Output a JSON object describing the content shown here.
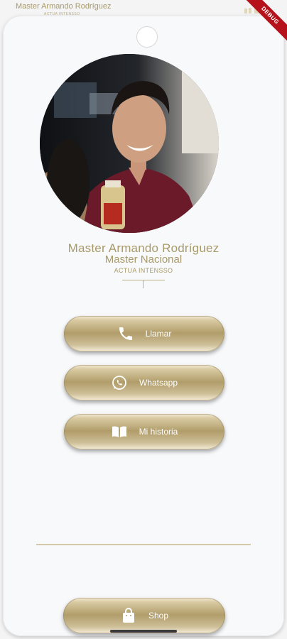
{
  "status_bar": {
    "title": "Master Armando Rodríguez",
    "subtitle": "ACTUA INTENSSO",
    "debug_label": "DEBUG"
  },
  "profile": {
    "name": "Master Armando Rodríguez",
    "title": "Master Nacional",
    "company": "ACTUA INTENSSO"
  },
  "actions": {
    "call_label": "Llamar",
    "whatsapp_label": "Whatsapp",
    "story_label": "Mi historia",
    "shop_label": "Shop"
  },
  "colors": {
    "gold": "#a89a6a",
    "background": "#f8f9fb",
    "debug": "#b5121b"
  },
  "icons": [
    "phone-icon",
    "whatsapp-icon",
    "book-icon",
    "shopping-bag-icon"
  ]
}
